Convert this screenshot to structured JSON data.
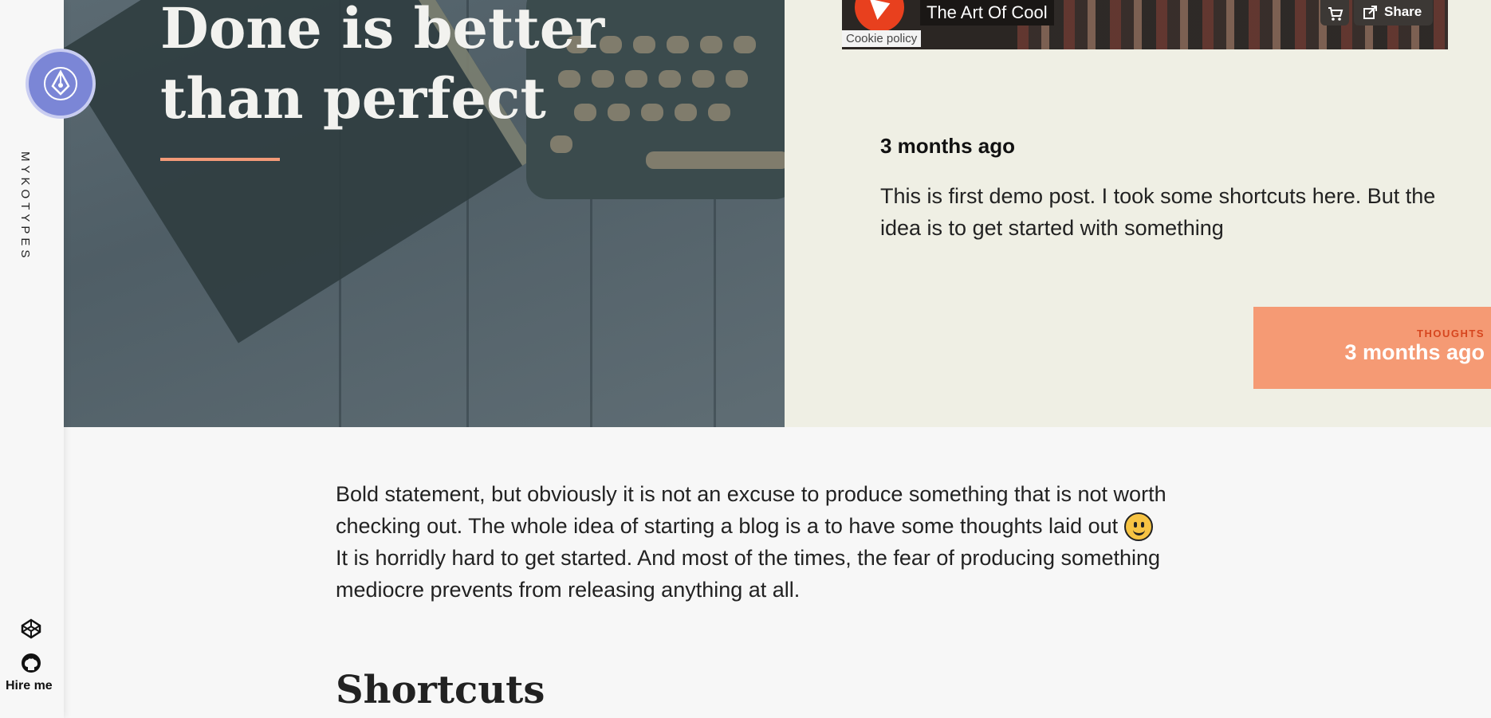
{
  "sidebar": {
    "brand": "MYKOTYPES",
    "hire_label": "Hire me",
    "icons": [
      "pen-nib-logo-icon",
      "codepen-icon",
      "github-icon"
    ],
    "logo_color": "#7b86d6"
  },
  "hero": {
    "title": "Done is better than perfect",
    "accent": "#f39a78"
  },
  "video": {
    "title": "The Art Of Cool",
    "cookie_label": "Cookie policy",
    "share_label": "Share"
  },
  "post": {
    "date": "3 months ago",
    "excerpt": "This is first demo post. I took some shortcuts here. But the idea is to get started with something",
    "tag": "THOUGHTS",
    "tag_date": "3 months ago",
    "tag_color": "#f59a74"
  },
  "content": {
    "paragraph1": "Bold statement, but obviously it is not an excuse to produce something that is not worth checking out. The whole idea of starting a blog is a to have some thoughts laid out",
    "paragraph2": "It is horridly hard to get started. And most of the times, the fear of producing something mediocre prevents from releasing anything at all.",
    "heading": "Shortcuts"
  }
}
